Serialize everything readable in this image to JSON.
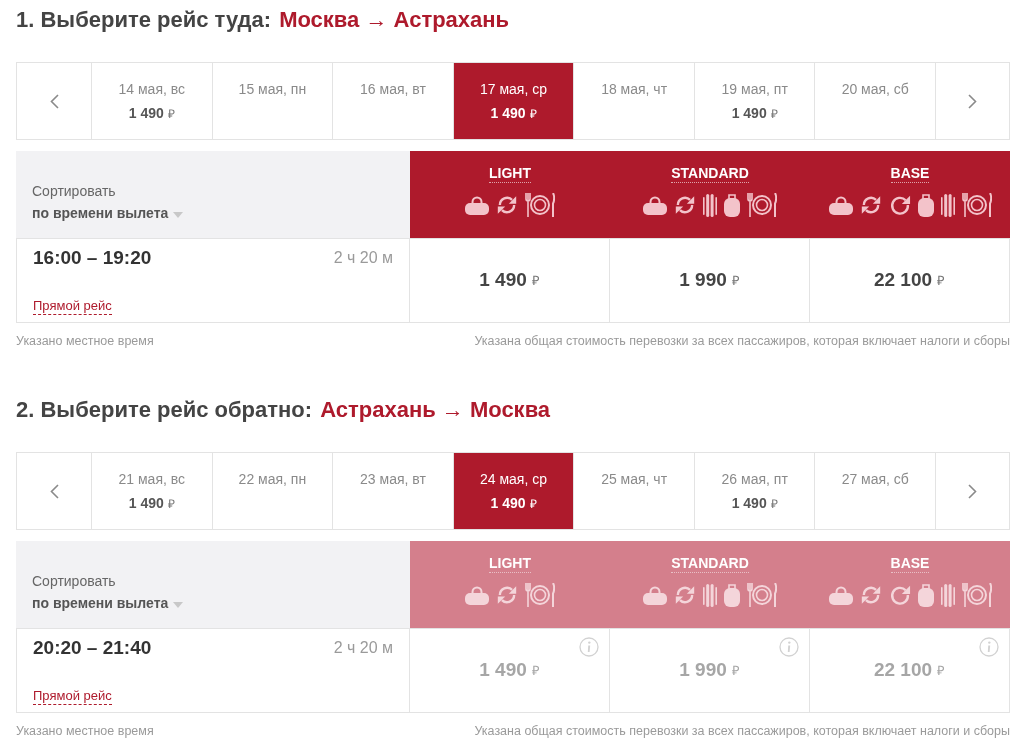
{
  "sections": [
    {
      "title": "1. Выберите рейс туда:",
      "route": "Москва → Астрахань",
      "disabled": false,
      "dates": [
        {
          "date": "14 мая, вс",
          "amount": "1 490",
          "currency": "₽",
          "selected": false
        },
        {
          "date": "15 мая, пн",
          "selected": false
        },
        {
          "date": "16 мая, вт",
          "selected": false
        },
        {
          "date": "17 мая, ср",
          "amount": "1 490",
          "currency": "₽",
          "selected": true
        },
        {
          "date": "18 мая, чт",
          "selected": false
        },
        {
          "date": "19 мая, пт",
          "amount": "1 490",
          "currency": "₽",
          "selected": false
        },
        {
          "date": "20 мая, сб",
          "selected": false
        }
      ],
      "sort": {
        "label": "Сортировать",
        "value": "по времени вылета"
      },
      "fares": [
        {
          "name": "LIGHT",
          "features": [
            {
              "kind": "bag"
            },
            {
              "kind": "cycle"
            },
            {
              "kind": "meal"
            }
          ]
        },
        {
          "name": "STANDARD",
          "features": [
            {
              "kind": "bag"
            },
            {
              "kind": "cycle"
            },
            {
              "kind": "skis"
            },
            {
              "kind": "suitcase"
            },
            {
              "kind": "meal"
            }
          ]
        },
        {
          "name": "BASE",
          "features": [
            {
              "kind": "bag"
            },
            {
              "kind": "cycle"
            },
            {
              "kind": "redo"
            },
            {
              "kind": "suitcase"
            },
            {
              "kind": "skis"
            },
            {
              "kind": "meal"
            }
          ]
        }
      ],
      "flight": {
        "times": "16:00 – 19:20",
        "duration": "2 ч 20 м",
        "link": "Прямой рейс",
        "prices": [
          {
            "amount": "1 490",
            "currency": "₽",
            "info": false
          },
          {
            "amount": "1 990",
            "currency": "₽",
            "info": false
          },
          {
            "amount": "22 100",
            "currency": "₽",
            "info": false
          }
        ]
      },
      "notes": {
        "left": "Указано местное время",
        "right": "Указана общая стоимость перевозки за всех пассажиров, которая включает налоги и сборы"
      }
    },
    {
      "title": "2. Выберите рейс обратно:",
      "route": "Астрахань → Москва",
      "disabled": true,
      "dates": [
        {
          "date": "21 мая, вс",
          "amount": "1 490",
          "currency": "₽",
          "selected": false
        },
        {
          "date": "22 мая, пн",
          "selected": false
        },
        {
          "date": "23 мая, вт",
          "selected": false
        },
        {
          "date": "24 мая, ср",
          "amount": "1 490",
          "currency": "₽",
          "selected": true
        },
        {
          "date": "25 мая, чт",
          "selected": false
        },
        {
          "date": "26 мая, пт",
          "amount": "1 490",
          "currency": "₽",
          "selected": false
        },
        {
          "date": "27 мая, сб",
          "selected": false
        }
      ],
      "sort": {
        "label": "Сортировать",
        "value": "по времени вылета"
      },
      "fares": [
        {
          "name": "LIGHT",
          "features": [
            {
              "kind": "bag"
            },
            {
              "kind": "cycle"
            },
            {
              "kind": "meal"
            }
          ]
        },
        {
          "name": "STANDARD",
          "features": [
            {
              "kind": "bag"
            },
            {
              "kind": "cycle"
            },
            {
              "kind": "skis"
            },
            {
              "kind": "suitcase"
            },
            {
              "kind": "meal"
            }
          ]
        },
        {
          "name": "BASE",
          "features": [
            {
              "kind": "bag"
            },
            {
              "kind": "cycle"
            },
            {
              "kind": "redo"
            },
            {
              "kind": "suitcase"
            },
            {
              "kind": "skis"
            },
            {
              "kind": "meal"
            }
          ]
        }
      ],
      "flight": {
        "times": "20:20 – 21:40",
        "duration": "2 ч 20 м",
        "link": "Прямой рейс",
        "prices": [
          {
            "amount": "1 490",
            "currency": "₽",
            "info": true
          },
          {
            "amount": "1 990",
            "currency": "₽",
            "info": true
          },
          {
            "amount": "22 100",
            "currency": "₽",
            "info": true
          }
        ]
      },
      "notes": {
        "left": "Указано местное время",
        "right": "Указана общая стоимость перевозки за всех пассажиров, которая включает налоги и сборы"
      }
    }
  ]
}
